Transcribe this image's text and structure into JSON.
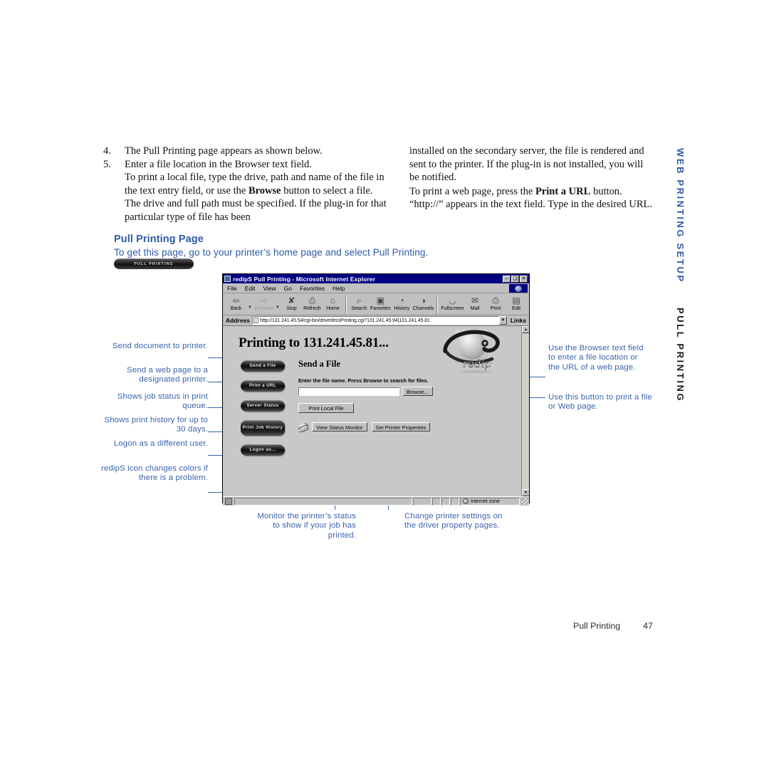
{
  "body_text": {
    "steps": [
      {
        "num": "4.",
        "text": "The Pull Printing page appears as shown below."
      },
      {
        "num": "5.",
        "text": "Enter a file location in the Browser text field."
      }
    ],
    "left_para_1_a": "To print a local file, type the drive, path and name of the file in the text entry field, or use the ",
    "left_para_1_bold": "Browse",
    "left_para_1_b": " button to select a file. The drive and full path must be specified. If the plug-in for that particular type of file has been",
    "right_para_1": "installed on the secondary server, the file is rendered and sent to the printer. If the plug-in is not installed, you will be notified.",
    "right_para_2_a": "To print a web page, press the ",
    "right_para_2_bold": "Print a URL",
    "right_para_2_b": " button. “http://” appears in the text field. Type in the desired URL."
  },
  "section": {
    "heading": "Pull Printing Page",
    "subtitle": "To get this page, go to your printer’s home page and select Pull Printing.",
    "badge_label": "PULL PRINTING",
    "heading_color": "#2d5aa8"
  },
  "browser": {
    "title": "redipS Pull Printing - Microsoft Internet Explorer",
    "window_buttons": [
      "–",
      "❑",
      "✕"
    ],
    "menus": [
      "File",
      "Edit",
      "View",
      "Go",
      "Favorites",
      "Help"
    ],
    "toolbar": [
      {
        "label": "Back",
        "icon": "back-arrow-icon",
        "glyph": "⇦",
        "dim": false,
        "dropdown": true
      },
      {
        "label": "Forward",
        "icon": "forward-arrow-icon",
        "glyph": "⇨",
        "dim": true,
        "dropdown": true
      },
      {
        "label": "Stop",
        "icon": "stop-icon",
        "glyph": "⊗",
        "dim": false,
        "dropdown": false
      },
      {
        "label": "Refresh",
        "icon": "refresh-icon",
        "glyph": "❐",
        "dim": false,
        "dropdown": false
      },
      {
        "label": "Home",
        "icon": "home-icon",
        "glyph": "⌂",
        "dim": false,
        "dropdown": false
      },
      {
        "label": "Search",
        "icon": "search-icon",
        "glyph": "⌕",
        "dim": false,
        "dropdown": false
      },
      {
        "label": "Favorites",
        "icon": "favorites-icon",
        "glyph": "▣",
        "dim": false,
        "dropdown": false
      },
      {
        "label": "History",
        "icon": "history-icon",
        "glyph": "◔",
        "dim": false,
        "dropdown": false
      },
      {
        "label": "Channels",
        "icon": "channels-icon",
        "glyph": "◑",
        "dim": false,
        "dropdown": false
      },
      {
        "label": "Fullscreen",
        "icon": "fullscreen-icon",
        "glyph": "◱",
        "dim": false,
        "dropdown": false
      },
      {
        "label": "Mail",
        "icon": "mail-icon",
        "glyph": "✉",
        "dim": false,
        "dropdown": false
      },
      {
        "label": "Print",
        "icon": "print-icon",
        "glyph": "⎙",
        "dim": false,
        "dropdown": false
      },
      {
        "label": "Edit",
        "icon": "edit-icon",
        "glyph": "▤",
        "dim": false,
        "dropdown": false
      }
    ],
    "address_label": "Address",
    "address_value": "http://131.241.45.54/cgi-bin/driverlessPrinting.cgi?131.241.45.94|131.241.45.81",
    "links_label": "Links",
    "status_zone": "Internet zone"
  },
  "page": {
    "title": "Printing to 131.241.45.81...",
    "nav_buttons": [
      {
        "label": "Send a File",
        "name": "send-a-file-button"
      },
      {
        "label": "Print a URL",
        "name": "print-a-url-button"
      },
      {
        "label": "Server Status",
        "name": "server-status-button"
      },
      {
        "label": "Print Job History",
        "name": "print-job-history-button"
      },
      {
        "label": "Logon as...",
        "name": "logon-as-button"
      }
    ],
    "form_heading": "Send a File",
    "form_note": "Enter the file name. Press Browse to search for files.",
    "file_input_value": "",
    "browse_label": "Browse...",
    "print_local_file_label": "Print Local File",
    "view_status_monitor_label": "View Status Monitor",
    "set_printer_properties_label": "Set Printer Properties"
  },
  "callouts": {
    "left": [
      "Send document to printer.",
      "Send a web page to a designated printer.",
      "Shows job status in print queue.",
      "Shows print history for up to 30 days.",
      "Logon as a different user.",
      "redipS icon changes colors if there is a problem."
    ],
    "right": [
      "Use the Browser text field to enter a file location or the URL of a web page.",
      "Use this button to print a file or Web page."
    ],
    "bottom": [
      "Monitor the printer’s status to show if your job has printed.",
      "Change printer settings on the driver property pages."
    ],
    "color": "#3a63ad"
  },
  "side_heads": {
    "primary": "WEB PRINTING SETUP",
    "secondary": "PULL PRINTING"
  },
  "footer": {
    "chapter": "Pull Printing",
    "page_number": "47"
  }
}
